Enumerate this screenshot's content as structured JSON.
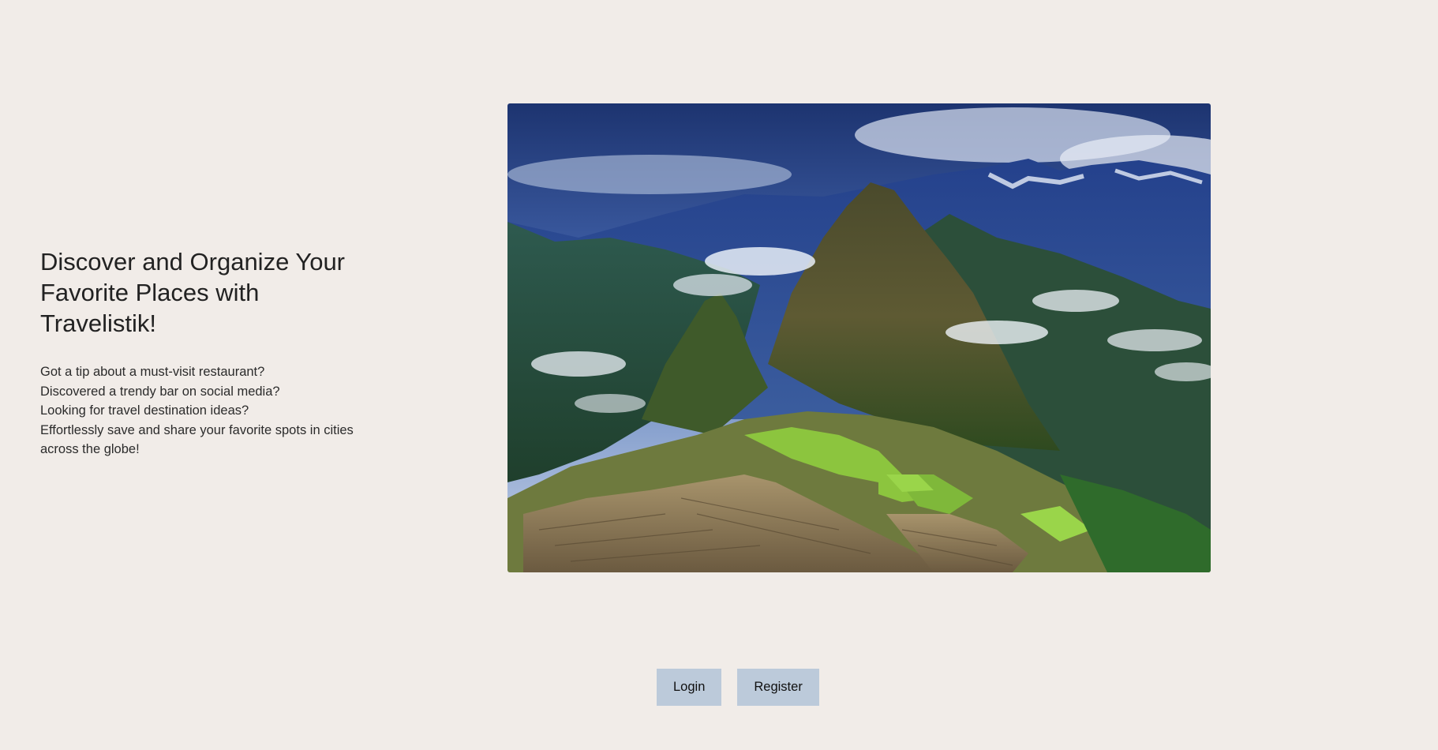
{
  "hero": {
    "headline": "Discover and Organize Your Favorite Places with Travelistik!",
    "lines": [
      "Got a tip about a must-visit restaurant?",
      "Discovered a trendy bar on social media?",
      "Looking for travel destination ideas?",
      "Effortlessly save and share your favorite spots in cities across the globe!"
    ]
  },
  "actions": {
    "login_label": "Login",
    "register_label": "Register"
  },
  "colors": {
    "background": "#f1ece8",
    "button": "#bccada",
    "text": "#222222"
  }
}
